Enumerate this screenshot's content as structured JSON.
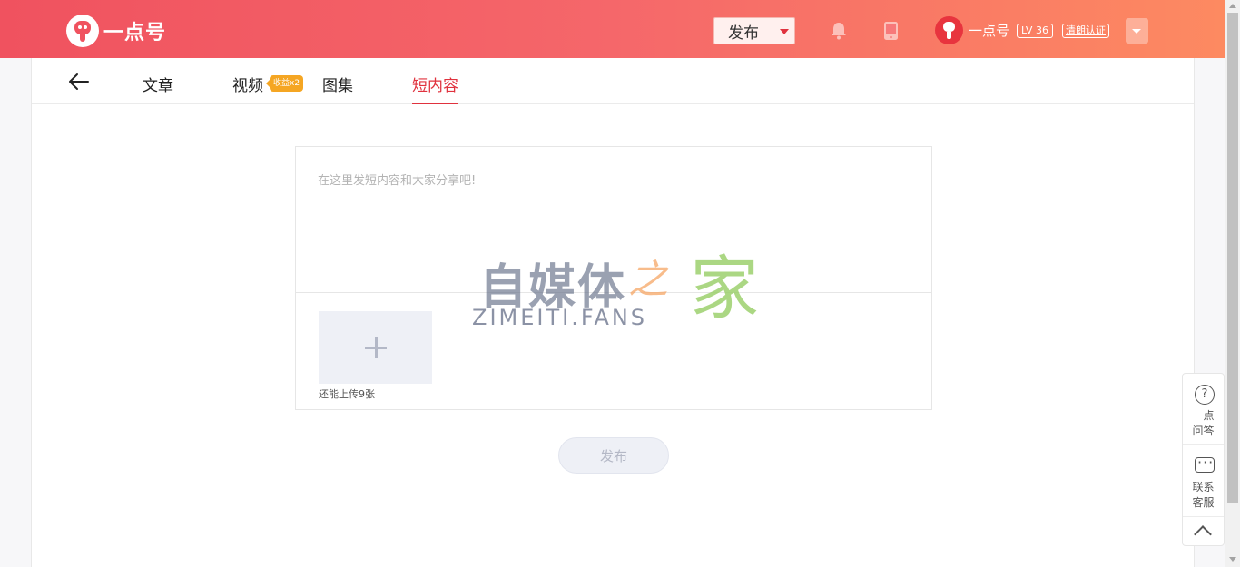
{
  "header": {
    "logo_text": "一点号",
    "publish_label": "发布",
    "user": {
      "name": "一点号",
      "level": "LV 36",
      "cert": "清朗认证"
    }
  },
  "tabs": [
    {
      "label": "文章"
    },
    {
      "label": "视频"
    },
    {
      "label": "图集"
    },
    {
      "label": "短内容"
    }
  ],
  "video_tag": "收益x2",
  "editor": {
    "placeholder": "在这里发短内容和大家分享吧!",
    "upload_hint": "还能上传9张"
  },
  "submit_label": "发布",
  "watermark": {
    "cn": "自媒体",
    "zhi": "之",
    "jia": "家",
    "en": "ZIMEITI.FANS"
  },
  "side": {
    "qa": {
      "line1": "一点",
      "line2": "问答"
    },
    "service": {
      "line1": "联系",
      "line2": "客服"
    }
  },
  "colors": {
    "accent": "#e0323e",
    "header_start": "#f0525f",
    "header_end": "#fd8a61",
    "tag": "#f5a623"
  }
}
